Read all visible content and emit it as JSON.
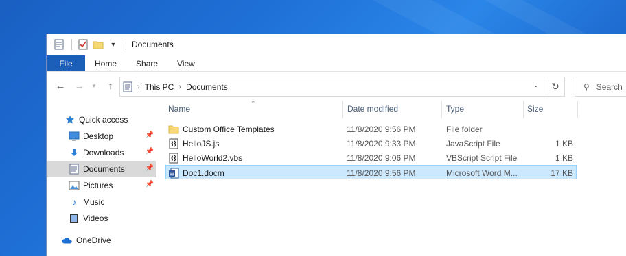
{
  "titlebar": {
    "title": "Documents",
    "qa_icons": [
      "properties-icon",
      "checkmark-icon",
      "folder-icon",
      "customize-dropdown-icon"
    ]
  },
  "ribbon": {
    "file_tab": "File",
    "tabs": [
      "Home",
      "Share",
      "View"
    ]
  },
  "address": {
    "crumbs": [
      "This PC",
      "Documents"
    ],
    "search_placeholder": "Search"
  },
  "nav": {
    "items": [
      {
        "label": "Quick access",
        "icon": "star-icon"
      },
      {
        "label": "Desktop",
        "icon": "desktop-icon",
        "pinned": true
      },
      {
        "label": "Downloads",
        "icon": "download-icon",
        "pinned": true
      },
      {
        "label": "Documents",
        "icon": "documents-icon",
        "pinned": true,
        "selected": true
      },
      {
        "label": "Pictures",
        "icon": "pictures-icon",
        "pinned": true
      },
      {
        "label": "Music",
        "icon": "music-icon"
      },
      {
        "label": "Videos",
        "icon": "videos-icon"
      },
      {
        "label": "OneDrive",
        "icon": "cloud-icon"
      }
    ]
  },
  "files": {
    "columns": {
      "name": "Name",
      "date": "Date modified",
      "type": "Type",
      "size": "Size"
    },
    "rows": [
      {
        "name": "Custom Office Templates",
        "date": "11/8/2020 9:56 PM",
        "type": "File folder",
        "size": "",
        "icon": "folder-icon"
      },
      {
        "name": "HelloJS.js",
        "date": "11/8/2020 9:33 PM",
        "type": "JavaScript File",
        "size": "1 KB",
        "icon": "script-icon"
      },
      {
        "name": "HelloWorld2.vbs",
        "date": "11/8/2020 9:06 PM",
        "type": "VBScript Script File",
        "size": "1 KB",
        "icon": "script-icon"
      },
      {
        "name": "Doc1.docm",
        "date": "11/8/2020 9:56 PM",
        "type": "Microsoft Word M...",
        "size": "17 KB",
        "icon": "word-doc-icon",
        "selected": true
      }
    ]
  },
  "colors": {
    "accent": "#1c5fb8",
    "selection": "#cce8ff",
    "selection_border": "#99d1ff",
    "desktop": "#1e6fd6"
  }
}
